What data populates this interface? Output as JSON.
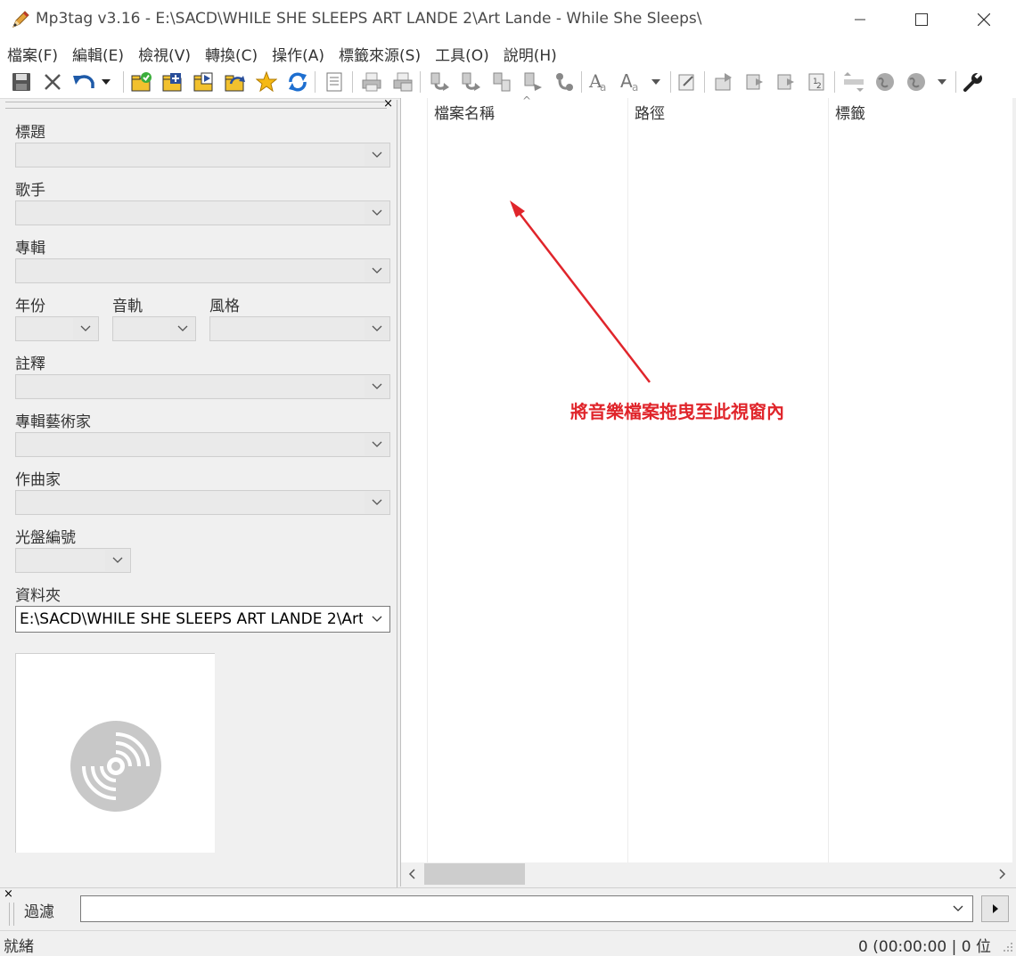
{
  "window": {
    "title": "Mp3tag v3.16  -  E:\\SACD\\WHILE SHE SLEEPS ART LANDE 2\\Art Lande - While She Sleeps\\",
    "app_icon": "mp3tag-pencil-icon",
    "controls": [
      "minimize-icon",
      "maximize-icon",
      "close-icon"
    ]
  },
  "menu": {
    "items": [
      {
        "label": "檔案(F)"
      },
      {
        "label": "編輯(E)"
      },
      {
        "label": "檢視(V)"
      },
      {
        "label": "轉換(C)"
      },
      {
        "label": "操作(A)"
      },
      {
        "label": "標籤來源(S)"
      },
      {
        "label": "工具(O)"
      },
      {
        "label": "說明(H)"
      }
    ]
  },
  "toolbar": {
    "buttons": [
      "save-icon",
      "remove-tag-icon",
      "undo-icon",
      "dropdown-icon",
      "change-directory-icon",
      "add-directory-icon",
      "playlist-icon",
      "open-folder-icon",
      "favorite-star-icon",
      "refresh-icon",
      "list-view-icon",
      "print-icon",
      "print-preview-icon",
      "tag-filename-icon",
      "filename-tag-icon",
      "filename-filename-icon",
      "text-file-tag-icon",
      "tag-tag-icon",
      "case-conversion-icon",
      "text-format-icon",
      "dropdown-icon",
      "edit-tag-icon",
      "export-icon",
      "playlist-export-icon",
      "playlist-create-icon",
      "numbering-icon",
      "actions-icon",
      "web-source-icon",
      "web-source-alt-icon",
      "dropdown-icon",
      "options-wrench-icon"
    ]
  },
  "tag_panel": {
    "fields": {
      "title": {
        "label": "標題",
        "value": ""
      },
      "artist": {
        "label": "歌手",
        "value": ""
      },
      "album": {
        "label": "專輯",
        "value": ""
      },
      "year": {
        "label": "年份",
        "value": ""
      },
      "track": {
        "label": "音軌",
        "value": ""
      },
      "genre": {
        "label": "風格",
        "value": ""
      },
      "comment": {
        "label": "註釋",
        "value": ""
      },
      "album_artist": {
        "label": "專輯藝術家",
        "value": ""
      },
      "composer": {
        "label": "作曲家",
        "value": ""
      },
      "disc_number": {
        "label": "光盤編號",
        "value": ""
      },
      "directory": {
        "label": "資料夾",
        "value": "E:\\SACD\\WHILE SHE SLEEPS ART LANDE 2\\Art"
      }
    },
    "artwork_icon": "cd-disc-placeholder-icon"
  },
  "file_list": {
    "columns": [
      "檔案名稱",
      "路徑",
      "標籤"
    ],
    "rows": [],
    "hint": "將音樂檔案拖曳至此視窗內"
  },
  "filter": {
    "label": "過濾",
    "value": ""
  },
  "status": {
    "left": "就緒",
    "right": "0 (00:00:00 | 0 位"
  },
  "colors": {
    "hint_red": "#e0252b",
    "background": "#f0f0f0"
  }
}
